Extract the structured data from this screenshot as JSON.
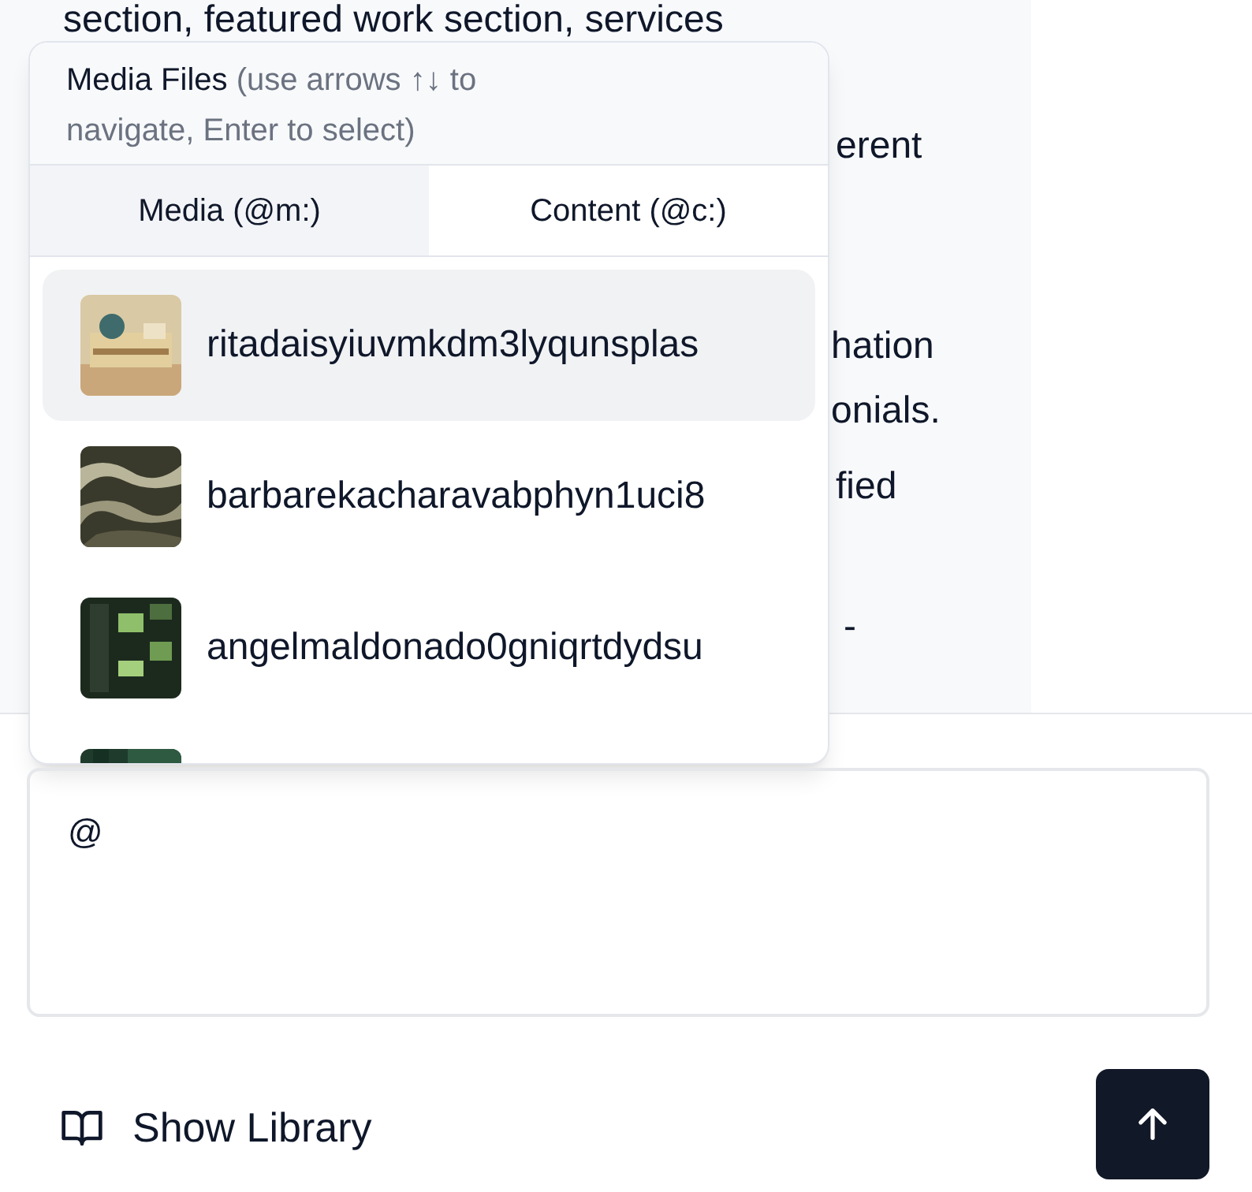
{
  "message_fragments": [
    "section, featured work section, services",
    "erent",
    "hation",
    "onials.",
    "fied",
    "-"
  ],
  "popup": {
    "title": "Media Files",
    "hint": "(use arrows ↑↓ to navigate, Enter to select)",
    "tabs": [
      {
        "label": "Media (@m:)",
        "selected": true
      },
      {
        "label": "Content (@c:)",
        "selected": false
      }
    ],
    "items": [
      {
        "name": "ritadaisyiuvmkdm3lyqunsplas",
        "selected": true
      },
      {
        "name": "barbarekacharavabphyn1uci8",
        "selected": false
      },
      {
        "name": "angelmaldonado0gniqrtdydsu",
        "selected": false
      },
      {
        "selected": false
      }
    ]
  },
  "composer": {
    "value": "@"
  },
  "library_button": "Show Library"
}
